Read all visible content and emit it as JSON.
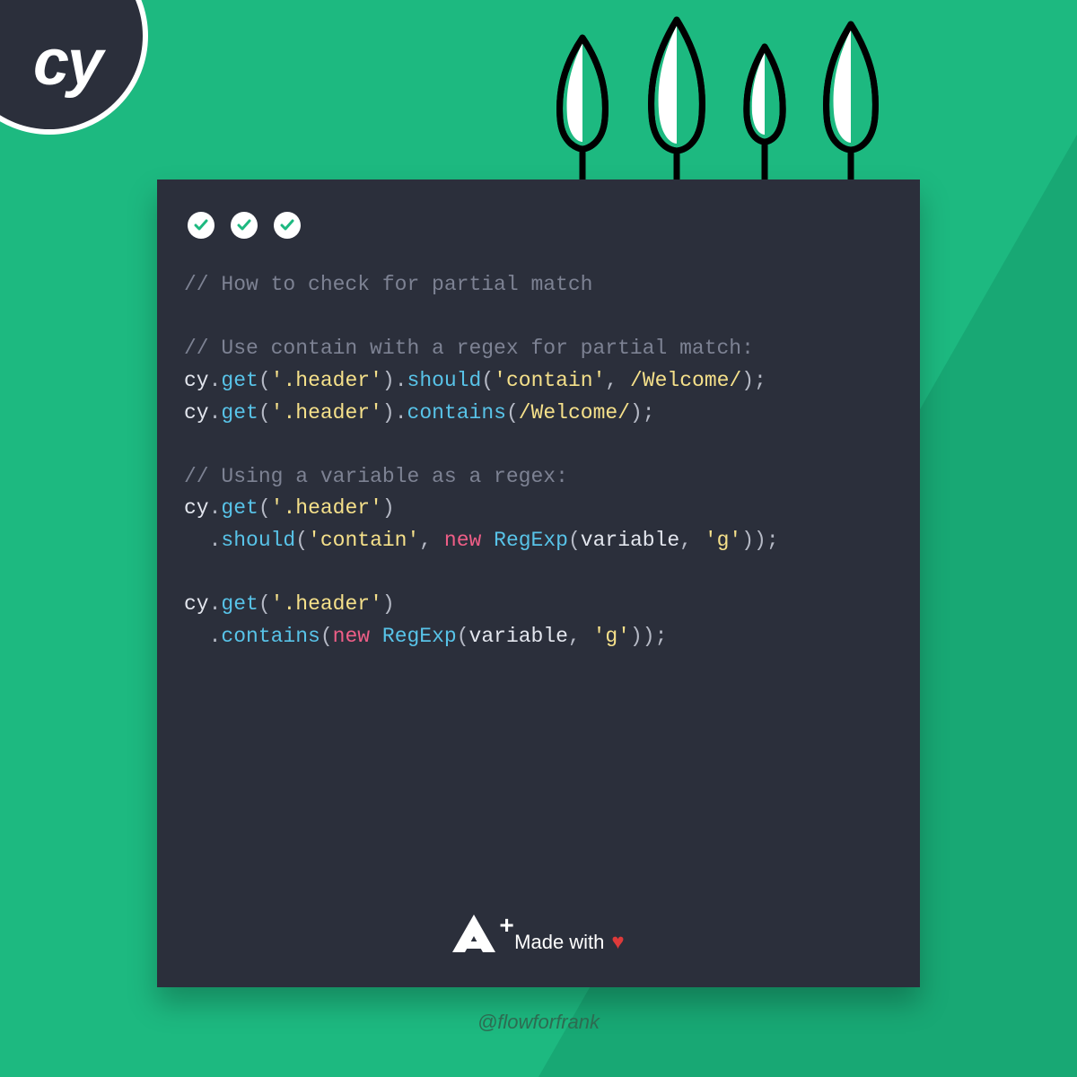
{
  "logo": {
    "text": "cy"
  },
  "code": {
    "comment1": "// How to check for partial match",
    "comment2": "// Use contain with a regex for partial match:",
    "comment3": "// Using a variable as a regex:",
    "cy": "cy",
    "dot": ".",
    "get": "get",
    "should": "should",
    "contains_m": "contains",
    "lpar": "(",
    "rpar": ")",
    "semi": ";",
    "comma": ", ",
    "str_header": "'.header'",
    "str_contain": "'contain'",
    "regex_welcome": "/Welcome/",
    "kw_new": "new",
    "class_regexp": "RegExp",
    "var_variable": "variable",
    "str_g": "'g'"
  },
  "footer": {
    "aplus_a": "A",
    "aplus_plus": "+",
    "made_with": "Made with",
    "heart": "♥"
  },
  "handle": "@flowforfrank"
}
